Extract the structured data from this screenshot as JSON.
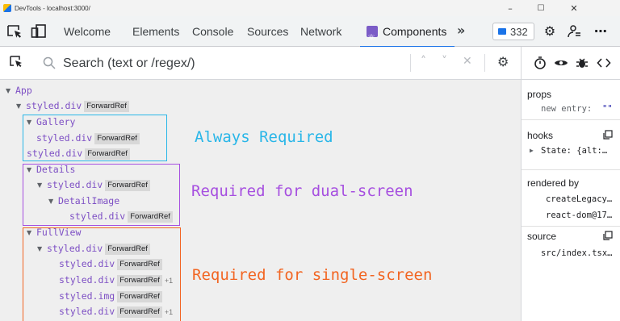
{
  "window": {
    "title": "DevTools - localhost:3000/",
    "minimize_glyph": "–",
    "maximize_glyph": "☐",
    "close_glyph": "✕"
  },
  "tabs": [
    {
      "label": "Welcome"
    },
    {
      "label": "Elements"
    },
    {
      "label": "Console"
    },
    {
      "label": "Sources"
    },
    {
      "label": "Network"
    },
    {
      "label": "Components",
      "active": true
    }
  ],
  "toolbar": {
    "more_tabs_glyph": "»",
    "issues_count": "332",
    "settings_glyph": "⚙",
    "customize_glyph": "⋯"
  },
  "search": {
    "placeholder": "Search (text or /regex/)",
    "prev_glyph": "˄",
    "next_glyph": "˅",
    "clear_glyph": "✕"
  },
  "tree": {
    "rows": [
      {
        "arrow": "▼",
        "name": "App",
        "badge": "",
        "extra": ""
      },
      {
        "arrow": "▼",
        "name": "styled.div",
        "badge": "ForwardRef",
        "extra": ""
      },
      {
        "arrow": "▼",
        "name": "Gallery",
        "badge": "",
        "extra": ""
      },
      {
        "arrow": "",
        "name": "styled.div",
        "badge": "ForwardRef",
        "extra": ""
      },
      {
        "arrow": "",
        "name": "styled.div",
        "badge": "ForwardRef",
        "extra": ""
      },
      {
        "arrow": "▼",
        "name": "Details",
        "badge": "",
        "extra": ""
      },
      {
        "arrow": "▼",
        "name": "styled.div",
        "badge": "ForwardRef",
        "extra": ""
      },
      {
        "arrow": "▼",
        "name": "DetailImage",
        "badge": "",
        "extra": ""
      },
      {
        "arrow": "",
        "name": "styled.div",
        "badge": "ForwardRef",
        "extra": ""
      },
      {
        "arrow": "▼",
        "name": "FullView",
        "badge": "",
        "extra": ""
      },
      {
        "arrow": "▼",
        "name": "styled.div",
        "badge": "ForwardRef",
        "extra": ""
      },
      {
        "arrow": "",
        "name": "styled.div",
        "badge": "ForwardRef",
        "extra": ""
      },
      {
        "arrow": "",
        "name": "styled.div",
        "badge": "ForwardRef",
        "extra": "+1"
      },
      {
        "arrow": "",
        "name": "styled.img",
        "badge": "ForwardRef",
        "extra": ""
      },
      {
        "arrow": "",
        "name": "styled.div",
        "badge": "ForwardRef",
        "extra": "+1"
      }
    ]
  },
  "annotations": [
    {
      "text": "Always Required",
      "color": "#29b6e8"
    },
    {
      "text": "Required for dual-screen",
      "color": "#a64fe0"
    },
    {
      "text": "Required for single-screen",
      "color": "#f26522"
    }
  ],
  "panel": {
    "props_title": "props",
    "props_entry_key": "new entry:",
    "props_entry_value": "\"\"",
    "hooks_title": "hooks",
    "hooks_state": "State: {alt:…",
    "rendered_by_title": "rendered by",
    "rendered_by": [
      "createLegacy…",
      "react-dom@17…"
    ],
    "source_title": "source",
    "source_file": "src/index.tsx…"
  },
  "colors": {
    "component_name": "#7d4fc4",
    "tree_bg": "#efefef",
    "active_tab_underline": "#1a73e8",
    "issues_icon": "#1a73e8"
  }
}
